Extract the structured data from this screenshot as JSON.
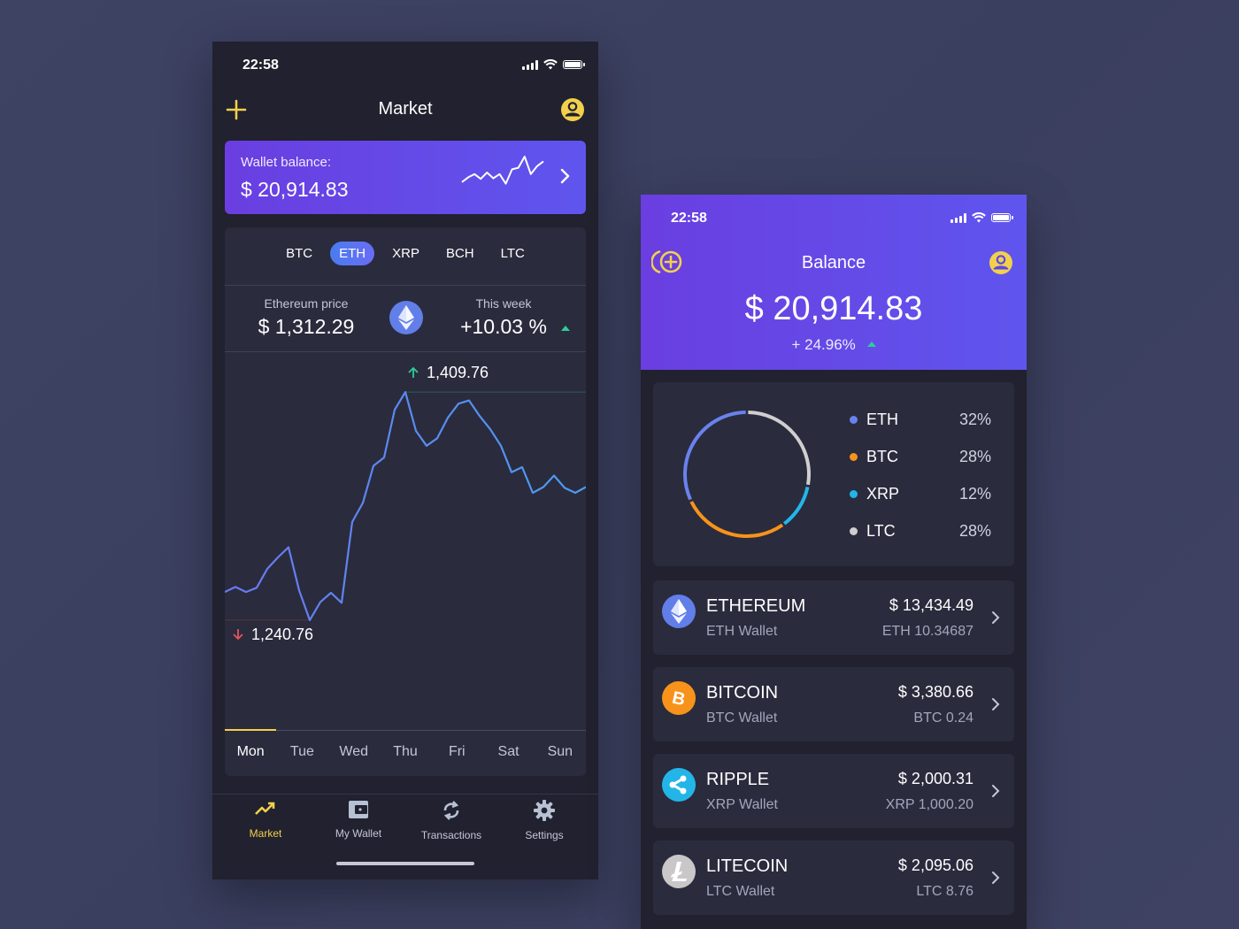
{
  "colors": {
    "accent_yellow": "#f2d04b",
    "up_green": "#2ecc9a",
    "down_red": "#e5545b",
    "line_blue": "#5b8cf5",
    "eth": "#6a82ee",
    "btc": "#f7931a",
    "xrp": "#23b5e8",
    "ltc": "#cfcfcf"
  },
  "market_screen": {
    "status_time": "22:58",
    "title": "Market",
    "add_icon": "plus-icon",
    "profile_icon": "user-icon",
    "wallet_card": {
      "label": "Wallet balance:",
      "value": "$ 20,914.83"
    },
    "coin_tabs": [
      {
        "label": "BTC",
        "active": false
      },
      {
        "label": "ETH",
        "active": true
      },
      {
        "label": "XRP",
        "active": false
      },
      {
        "label": "BCH",
        "active": false
      },
      {
        "label": "LTC",
        "active": false
      }
    ],
    "price": {
      "caption": "Ethereum price",
      "value": "$ 1,312.29"
    },
    "week": {
      "caption": "This week",
      "value": "+10.03 %"
    },
    "chart": {
      "high_label": "1,409.76",
      "low_label": "1,240.76"
    },
    "days": [
      {
        "label": "Mon",
        "active": true
      },
      {
        "label": "Tue",
        "active": false
      },
      {
        "label": "Wed",
        "active": false
      },
      {
        "label": "Thu",
        "active": false
      },
      {
        "label": "Fri",
        "active": false
      },
      {
        "label": "Sat",
        "active": false
      },
      {
        "label": "Sun",
        "active": false
      }
    ],
    "nav": [
      {
        "label": "Market",
        "icon": "trending-up-icon",
        "active": true
      },
      {
        "label": "My Wallet",
        "icon": "wallet-icon",
        "active": false
      },
      {
        "label": "Transactions",
        "icon": "refresh-icon",
        "active": false
      },
      {
        "label": "Settings",
        "icon": "gear-icon",
        "active": false
      }
    ]
  },
  "chart_data": {
    "type": "line",
    "title": "Ethereum price",
    "xlabel": "",
    "ylabel": "",
    "x_ticks": [
      "Mon",
      "Tue",
      "Wed",
      "Thu",
      "Fri",
      "Sat",
      "Sun"
    ],
    "y_max_annotation": 1409.76,
    "y_min_annotation": 1240.76,
    "ylim": [
      1160,
      1440
    ],
    "series": [
      {
        "name": "ETH",
        "values": [
          1262.0,
          1265.7,
          1262.0,
          1265.1,
          1279.1,
          1287.6,
          1295.0,
          1263.2,
          1241.2,
          1254.6,
          1261.4,
          1254.0,
          1313.8,
          1327.9,
          1355.3,
          1361.4,
          1396.8,
          1409.8,
          1381.1,
          1370.1,
          1375.6,
          1390.8,
          1401.2,
          1403.6,
          1392.1,
          1382.3,
          1370.1,
          1350.6,
          1354.3,
          1335.3,
          1339.6,
          1348.1,
          1339.0,
          1335.3,
          1339.6
        ]
      }
    ],
    "grid": false
  },
  "wallet_sparkline": [
    0.2,
    0.35,
    0.45,
    0.3,
    0.5,
    0.32,
    0.45,
    0.15,
    0.6,
    0.65,
    1.0,
    0.45,
    0.7,
    0.85
  ],
  "balance_screen": {
    "status_time": "22:58",
    "title": "Balance",
    "add_coin_icon": "add-coin-icon",
    "profile_icon": "user-icon",
    "total": "$ 20,914.83",
    "change": "+ 24.96%",
    "allocation": [
      {
        "name": "ETH",
        "percent": 32,
        "label": "32%",
        "color": "#6a82ee"
      },
      {
        "name": "BTC",
        "percent": 28,
        "label": "28%",
        "color": "#f7931a"
      },
      {
        "name": "XRP",
        "percent": 12,
        "label": "12%",
        "color": "#23b5e8"
      },
      {
        "name": "LTC",
        "percent": 28,
        "label": "28%",
        "color": "#cfcfcf"
      }
    ],
    "wallets": [
      {
        "name": "ETHEREUM",
        "sub": "ETH Wallet",
        "usd": "$ 13,434.49",
        "amount": "ETH 10.34687",
        "icon": "ethereum-icon"
      },
      {
        "name": "BITCOIN",
        "sub": "BTC Wallet",
        "usd": "$ 3,380.66",
        "amount": "BTC 0.24",
        "icon": "bitcoin-icon"
      },
      {
        "name": "RIPPLE",
        "sub": "XRP Wallet",
        "usd": "$ 2,000.31",
        "amount": "XRP 1,000.20",
        "icon": "ripple-icon"
      },
      {
        "name": "LITECOIN",
        "sub": "LTC Wallet",
        "usd": "$ 2,095.06",
        "amount": "LTC 8.76",
        "icon": "litecoin-icon"
      }
    ]
  }
}
